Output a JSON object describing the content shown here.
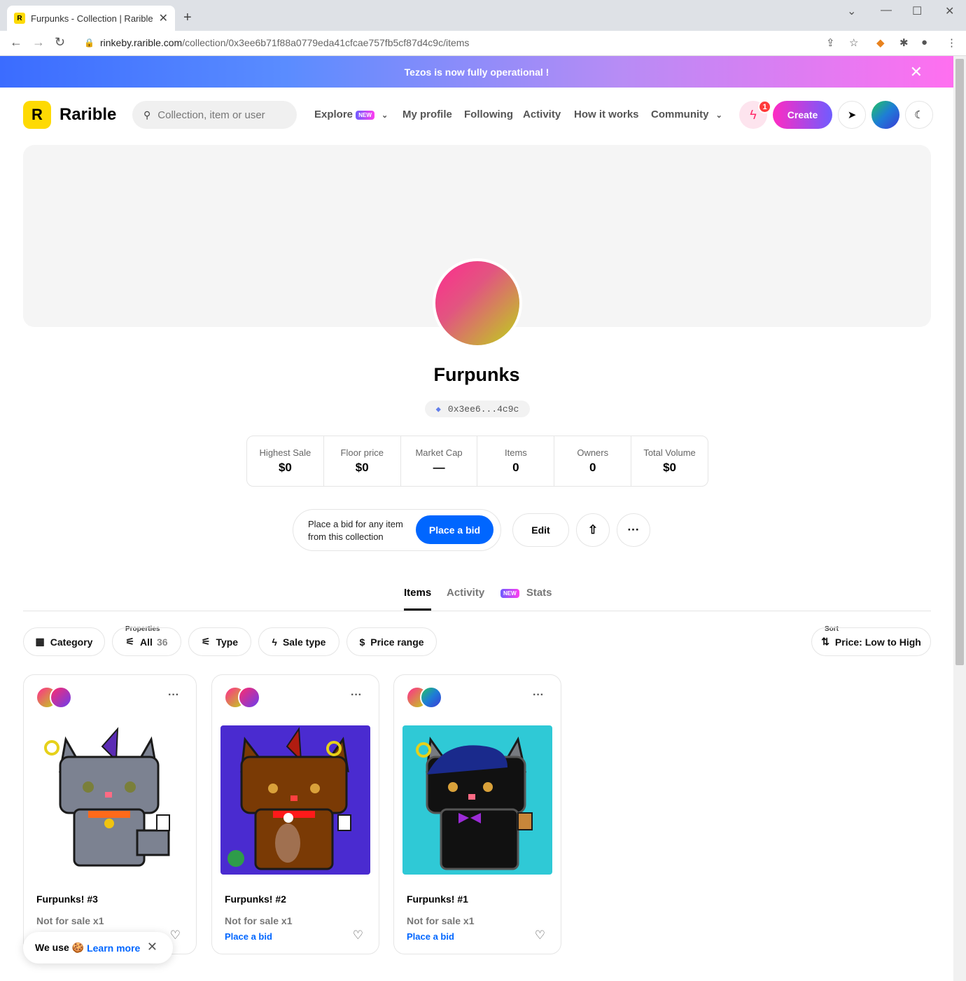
{
  "browser": {
    "tab_title": "Furpunks - Collection | Rarible",
    "url_host": "rinkeby.rarible.com",
    "url_path": "/collection/0x3ee6b71f88a0779eda41cfcae757fb5cf87d4c9c/items"
  },
  "banner": {
    "text": "Tezos is now fully operational !"
  },
  "header": {
    "logo": "Rarible",
    "search_placeholder": "Collection, item or user",
    "nav": {
      "explore": "Explore",
      "new_badge": "NEW",
      "my_profile": "My profile",
      "following": "Following",
      "activity": "Activity",
      "how_it_works": "How it works",
      "community": "Community"
    },
    "notification_count": "1",
    "create": "Create"
  },
  "collection": {
    "name": "Furpunks",
    "address": "0x3ee6...4c9c"
  },
  "stats": [
    {
      "label": "Highest Sale",
      "value": "$0"
    },
    {
      "label": "Floor price",
      "value": "$0"
    },
    {
      "label": "Market Cap",
      "value": "—"
    },
    {
      "label": "Items",
      "value": "0"
    },
    {
      "label": "Owners",
      "value": "0"
    },
    {
      "label": "Total Volume",
      "value": "$0"
    }
  ],
  "actions": {
    "bid_text": "Place a bid for any item from this collection",
    "place_bid": "Place a bid",
    "edit": "Edit"
  },
  "tabs": {
    "items": "Items",
    "activity": "Activity",
    "new_badge": "NEW",
    "stats": "Stats"
  },
  "filters": {
    "category": "Category",
    "properties_label": "Properties",
    "properties_value": "All",
    "properties_count": "36",
    "type": "Type",
    "sale_type": "Sale type",
    "price_range": "Price range",
    "sort_label": "Sort",
    "sort_value": "Price: Low to High"
  },
  "cards": [
    {
      "name": "Furpunks! #3",
      "sale": "Not for sale  x1",
      "bid": ""
    },
    {
      "name": "Furpunks! #2",
      "sale": "Not for sale  x1",
      "bid": "Place a bid"
    },
    {
      "name": "Furpunks! #1",
      "sale": "Not for sale  x1",
      "bid": "Place a bid"
    }
  ],
  "cookie": {
    "text": "We use 🍪",
    "learn_more": "Learn more"
  },
  "colors": {
    "accent": "#0066ff",
    "logo_yellow": "#feda03"
  }
}
